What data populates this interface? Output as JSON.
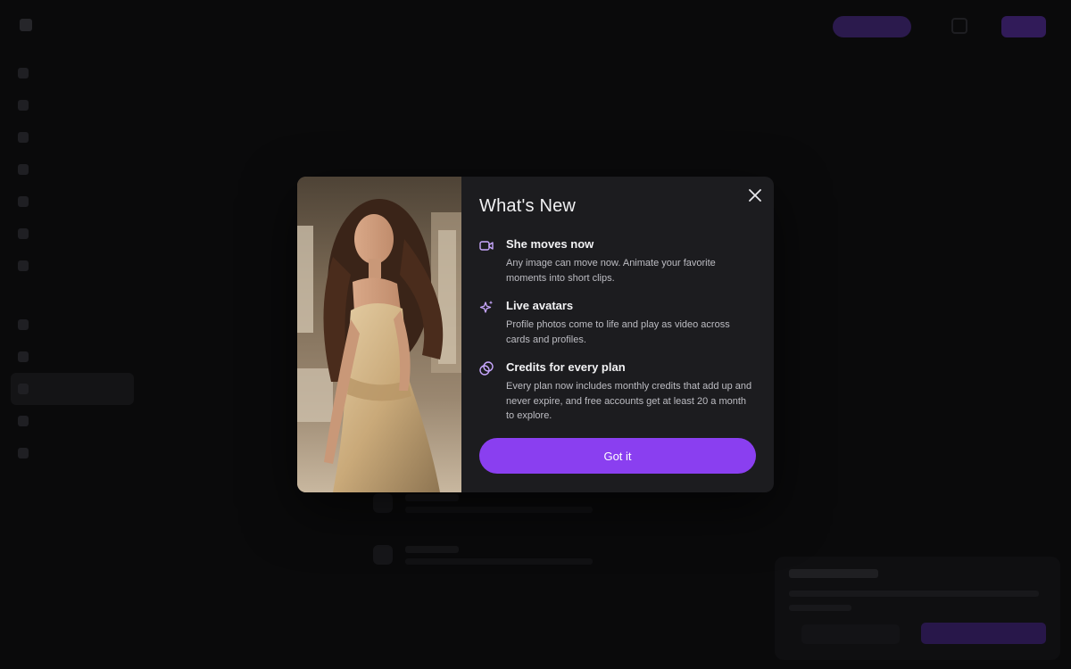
{
  "modal": {
    "title": "What's New",
    "features": [
      {
        "icon": "video-camera-icon",
        "title": "She moves now",
        "description": "Any image can move now. Animate your favorite moments into short clips."
      },
      {
        "icon": "sparkles-icon",
        "title": "Live avatars",
        "description": "Profile photos come to life and play as video across cards and profiles."
      },
      {
        "icon": "coins-icon",
        "title": "Credits for every plan",
        "description": "Every plan now includes monthly credits that add up and never expire, and free accounts get at least 20 a month to explore."
      }
    ],
    "button_label": "Got it"
  },
  "colors": {
    "accent": "#8a3ff0",
    "icon_tint": "#c9a8ff",
    "modal_bg": "#1c1c1f",
    "page_bg": "#0a0a0b"
  }
}
